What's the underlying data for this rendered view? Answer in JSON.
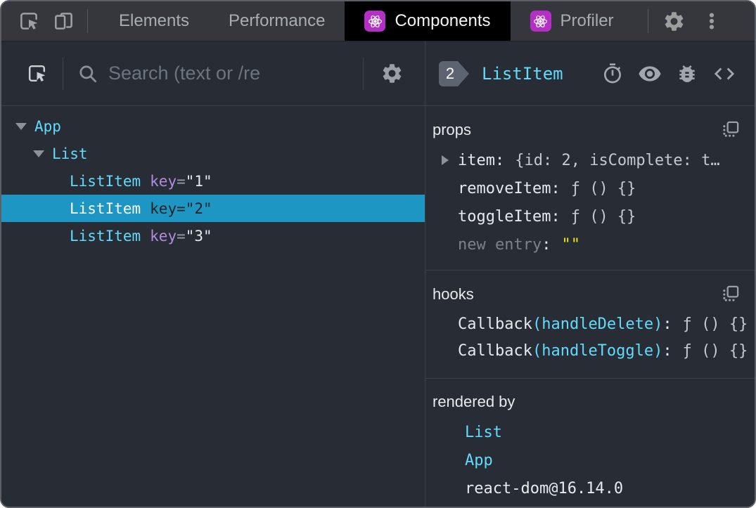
{
  "topbar": {
    "tabs": {
      "elements": "Elements",
      "performance": "Performance",
      "components": "Components",
      "profiler": "Profiler"
    }
  },
  "left": {
    "search_placeholder": "Search (text or /re",
    "tree": [
      {
        "name": "App",
        "depth": 0,
        "expanded": true
      },
      {
        "name": "List",
        "depth": 1,
        "expanded": true
      },
      {
        "name": "ListItem",
        "depth": 2,
        "key_label": "key",
        "key_value": "\"1\""
      },
      {
        "name": "ListItem",
        "depth": 2,
        "key_label": "key",
        "key_value": "\"2\"",
        "selected": true
      },
      {
        "name": "ListItem",
        "depth": 2,
        "key_label": "key",
        "key_value": "\"3\""
      }
    ]
  },
  "right": {
    "badge": "2",
    "title": "ListItem",
    "props": {
      "title": "props",
      "rows": [
        {
          "name": "item",
          "value": "{id: 2, isComplete: t…",
          "expandable": true
        },
        {
          "name": "removeItem",
          "value": "ƒ () {}"
        },
        {
          "name": "toggleItem",
          "value": "ƒ () {}"
        },
        {
          "name": "new entry",
          "value": "\"\""
        }
      ]
    },
    "hooks": {
      "title": "hooks",
      "rows": [
        {
          "name": "Callback",
          "paren": "(handleDelete)",
          "value": "ƒ () {}"
        },
        {
          "name": "Callback",
          "paren": "(handleToggle)",
          "value": "ƒ () {}"
        }
      ]
    },
    "rendered_by": {
      "title": "rendered by",
      "items": [
        {
          "label": "List",
          "link": true
        },
        {
          "label": "App",
          "link": true
        },
        {
          "label": "react-dom@16.14.0",
          "link": false
        }
      ]
    }
  },
  "punct": {
    "colon": ":",
    "eq": "="
  },
  "colors": {
    "component_cyan": "#61dafb",
    "key_purple": "#b18ce0",
    "selected_row_teal": "#1e96c3",
    "react_icon_magenta": "#b32fc5",
    "string_yellow": "#ece81a",
    "panel_background": "#282c34",
    "topbar_background": "#35373c",
    "active_tab_background": "#000000"
  }
}
